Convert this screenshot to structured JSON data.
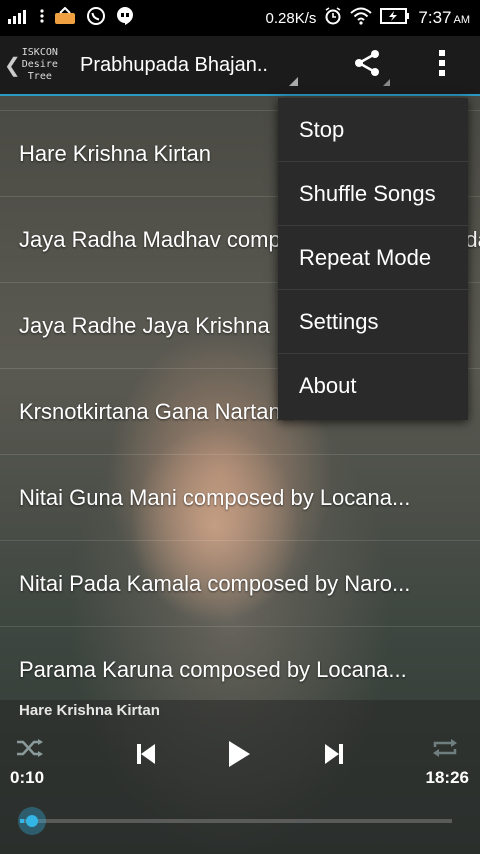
{
  "status_bar": {
    "speed": "0.28K/s",
    "time": "7:37",
    "ampm": "AM",
    "icons": [
      "signal-icon",
      "more-icon",
      "notification-icon",
      "whatsapp-icon",
      "hangouts-icon",
      "alarm-icon",
      "wifi-icon",
      "battery-icon"
    ]
  },
  "action_bar": {
    "logo_lines": [
      "ISKCON",
      "Desire",
      "Tree"
    ],
    "title": "Prabhupada Bhajan..",
    "accent": "#33b5e5"
  },
  "songs": [
    "Hare Krishna Kirtan",
    "Jaya Radha Madhav composed by Bhaktivinoda",
    "Jaya Radhe Jaya Krishna",
    "Krsnotkirtana Gana Nartana",
    "Nitai Guna Mani composed by Locana...",
    "Nitai Pada Kamala composed by Naro...",
    "Parama Karuna composed by Locana..."
  ],
  "menu": {
    "items": [
      "Stop",
      "Shuffle Songs",
      "Repeat Mode",
      "Settings",
      "About"
    ]
  },
  "player": {
    "now_playing": "Hare Krishna Kirtan",
    "elapsed": "0:10",
    "duration": "18:26",
    "progress_fraction": 0.009
  }
}
